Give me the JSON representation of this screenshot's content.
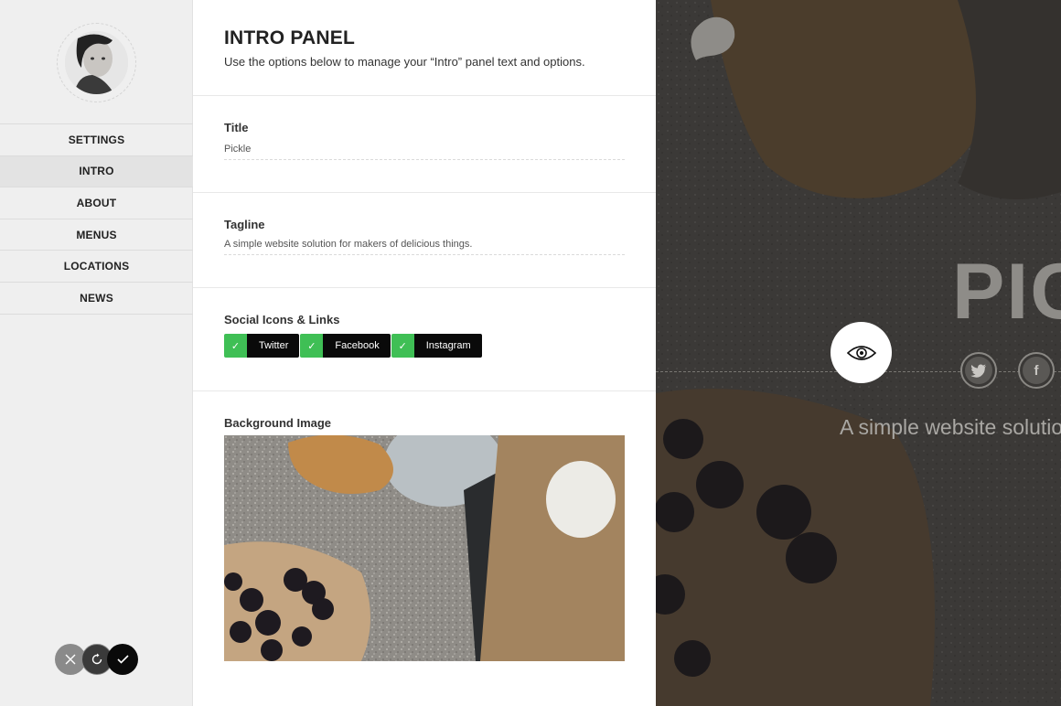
{
  "sidebar": {
    "nav": [
      {
        "label": "SETTINGS"
      },
      {
        "label": "INTRO"
      },
      {
        "label": "ABOUT"
      },
      {
        "label": "MENUS"
      },
      {
        "label": "LOCATIONS"
      },
      {
        "label": "NEWS"
      }
    ],
    "active_item": "INTRO",
    "actions": {
      "cancel_icon": "close-icon",
      "reset_icon": "refresh-icon",
      "save_icon": "check-icon"
    }
  },
  "panel": {
    "title": "INTRO PANEL",
    "description": "Use the options below to manage your “Intro” panel text and options.",
    "fields": {
      "title": {
        "label": "Title",
        "value": "Pickle"
      },
      "tagline": {
        "label": "Tagline",
        "value": "A simple website solution for makers of delicious things."
      },
      "social": {
        "label": "Social Icons & Links",
        "items": [
          {
            "label": "Twitter",
            "checked": true
          },
          {
            "label": "Facebook",
            "checked": true
          },
          {
            "label": "Instagram",
            "checked": true
          }
        ]
      },
      "background": {
        "label": "Background Image"
      }
    }
  },
  "preview": {
    "title": "PIC",
    "tagline": "A simple website solutio",
    "social_letters": {
      "facebook": "f"
    },
    "accent_check_color": "#3fbf55"
  }
}
